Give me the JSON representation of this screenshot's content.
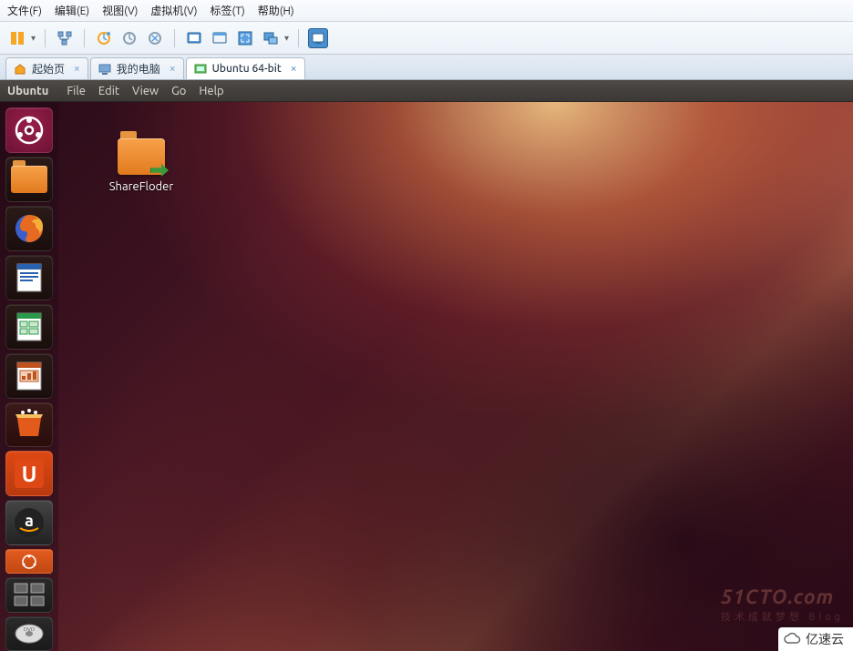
{
  "host_menu": {
    "file": "文件(F)",
    "edit": "编辑(E)",
    "view": "视图(V)",
    "vm": "虚拟机(V)",
    "tabs": "标签(T)",
    "help": "帮助(H)"
  },
  "host_tabs": [
    {
      "icon": "home-icon",
      "label": "起始页",
      "active": false
    },
    {
      "icon": "computer-icon",
      "label": "我的电脑",
      "active": false
    },
    {
      "icon": "vm-icon",
      "label": "Ubuntu 64-bit",
      "active": true
    }
  ],
  "toolbar_icons": [
    "power-on-icon",
    "dropdown-icon",
    "separator",
    "snapshot-tree-icon",
    "separator",
    "snapshot-take-icon",
    "snapshot-revert-icon",
    "snapshot-manage-icon",
    "separator",
    "fit-guest-icon",
    "fit-window-icon",
    "fullscreen-icon",
    "unity-icon",
    "separator",
    "console-view-icon"
  ],
  "ubuntu_menu": {
    "app": "Ubuntu",
    "file": "File",
    "edit": "Edit",
    "view": "View",
    "go": "Go",
    "help": "Help"
  },
  "launcher": [
    {
      "name": "dash-icon",
      "cls": "dash"
    },
    {
      "name": "files-icon",
      "cls": "nautilus"
    },
    {
      "name": "firefox-icon",
      "cls": "firefox"
    },
    {
      "name": "writer-icon",
      "cls": "writer"
    },
    {
      "name": "calc-icon",
      "cls": "calc"
    },
    {
      "name": "impress-icon",
      "cls": "impress"
    },
    {
      "name": "software-center-icon",
      "cls": "software"
    },
    {
      "name": "ubuntu-one-icon",
      "cls": "ubuntuone"
    },
    {
      "name": "amazon-icon",
      "cls": "amazon"
    },
    {
      "name": "stacked-app-icon",
      "cls": "stacked"
    },
    {
      "name": "workspace-switcher-icon",
      "cls": "workspace"
    },
    {
      "name": "dvd-icon",
      "cls": "dvd"
    }
  ],
  "desktop": {
    "folder_label": "ShareFloder"
  },
  "watermark": {
    "main": "51CTO.com",
    "sub": "技术成就梦想  Blog"
  },
  "badge": {
    "text": "亿速云"
  },
  "colors": {
    "ubuntu_orange": "#dd4814",
    "launcher_purple": "#6d1236"
  }
}
